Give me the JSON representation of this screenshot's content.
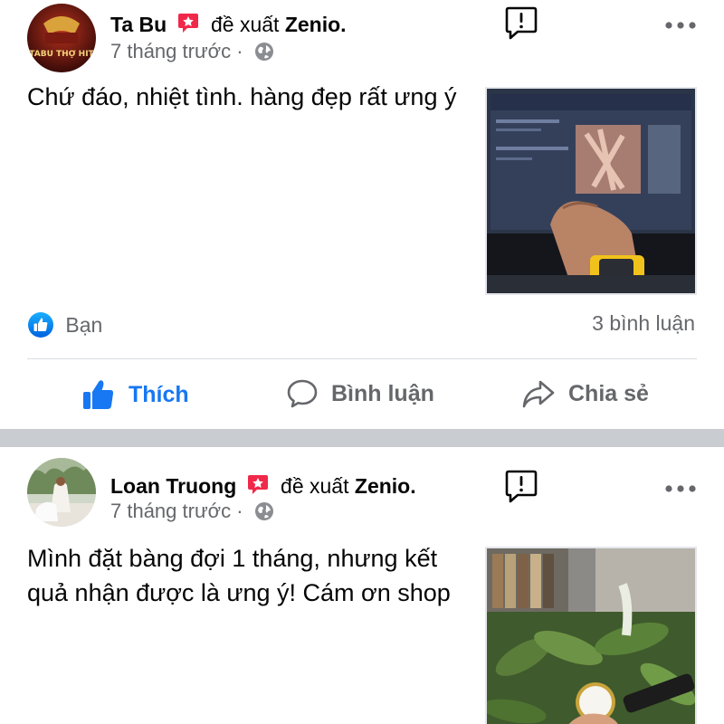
{
  "posts": [
    {
      "author": "Ta Bu",
      "verb": "đề xuất",
      "page": "Zenio.",
      "time": "7 tháng trước ·",
      "text": "Chứ đáo, nhiệt tình. hàng đẹp rất ưng ý",
      "avatar_text": "TABU THỢ HIT",
      "reaction_label": "Bạn",
      "comment_count": "3 bình luận"
    },
    {
      "author": "Loan Truong",
      "verb": "đề xuất",
      "page": "Zenio.",
      "time": "7 tháng trước ·",
      "text": "Mình đặt bàng đợi 1 tháng, nhưng kết quả nhận được là ưng ý! Cám ơn shop"
    }
  ],
  "actions": {
    "like": "Thích",
    "comment": "Bình luận",
    "share": "Chia sẻ"
  },
  "icons": {
    "recommend": "recommend-icon",
    "globe": "globe-icon",
    "report": "report-icon",
    "more": "more-options-icon",
    "like": "thumbs-up-icon",
    "comment": "comment-icon",
    "share": "share-icon"
  },
  "colors": {
    "accent": "#1877f2",
    "recommend": "#f02849",
    "secondary_text": "#65676b",
    "separator": "#c9ccd1"
  }
}
